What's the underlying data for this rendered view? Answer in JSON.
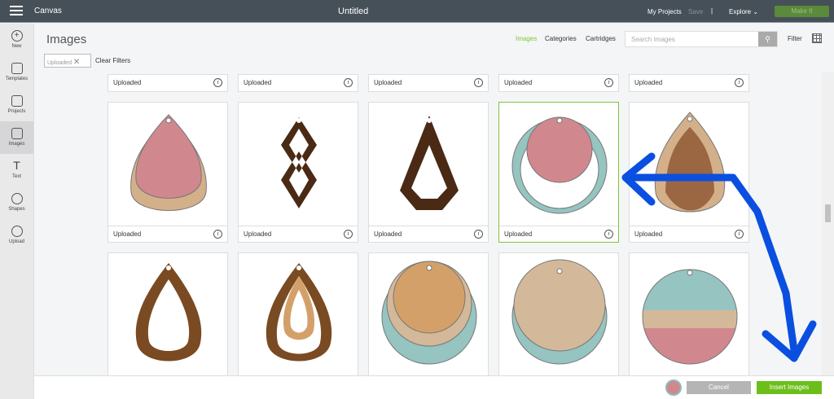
{
  "topbar": {
    "app": "Canvas",
    "title": "Untitled",
    "my_projects": "My Projects",
    "save": "Save",
    "sep": "|",
    "explore": "Explore",
    "make_it": "Make It"
  },
  "sidebar": [
    {
      "label": "New",
      "icon": "plus-icon"
    },
    {
      "label": "Templates",
      "icon": "shirt-icon"
    },
    {
      "label": "Projects",
      "icon": "projects-icon"
    },
    {
      "label": "Images",
      "icon": "image-icon"
    },
    {
      "label": "Text",
      "icon": "text-icon"
    },
    {
      "label": "Shapes",
      "icon": "shapes-icon"
    },
    {
      "label": "Upload",
      "icon": "upload-icon"
    }
  ],
  "header": {
    "title": "Images",
    "nav": [
      "Images",
      "Categories",
      "Cartridges"
    ],
    "search_placeholder": "Search Images",
    "filter": "Filter"
  },
  "filters": {
    "chip": "Uploaded",
    "clear": "Clear Filters"
  },
  "card_label": "Uploaded",
  "info": "i",
  "footer": {
    "cancel": "Cancel",
    "insert": "Insert Images"
  },
  "colors": {
    "accent": "#6cbf1b",
    "annotation": "#0a4fe0",
    "topbar": "#465059"
  }
}
